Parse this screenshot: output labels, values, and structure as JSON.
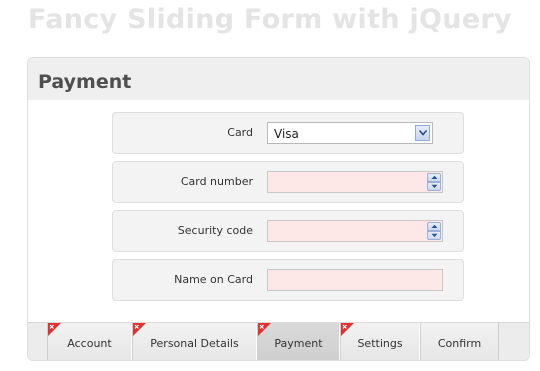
{
  "page_title": "Fancy Sliding Form with jQuery",
  "section": {
    "title": "Payment"
  },
  "fields": {
    "card": {
      "label": "Card",
      "value": "Visa",
      "options": [
        "Visa"
      ]
    },
    "card_number": {
      "label": "Card number",
      "value": ""
    },
    "security_code": {
      "label": "Security code",
      "value": ""
    },
    "name_on_card": {
      "label": "Name on Card",
      "value": ""
    }
  },
  "tabs": [
    {
      "label": "Account",
      "selected": false,
      "error": true
    },
    {
      "label": "Personal Details",
      "selected": false,
      "error": true
    },
    {
      "label": "Payment",
      "selected": true,
      "error": true
    },
    {
      "label": "Settings",
      "selected": false,
      "error": true
    },
    {
      "label": "Confirm",
      "selected": false,
      "error": false
    }
  ],
  "colors": {
    "invalid_input_bg": "#fde7e7",
    "error_flag": "#e03030",
    "title_text": "#e4e4e4",
    "section_title": "#4f4f4f"
  },
  "icons": {
    "dropdown": "chevron-down-icon",
    "spinner_up": "arrow-up-icon",
    "spinner_down": "arrow-down-icon",
    "error_flag": "error-corner-icon"
  }
}
